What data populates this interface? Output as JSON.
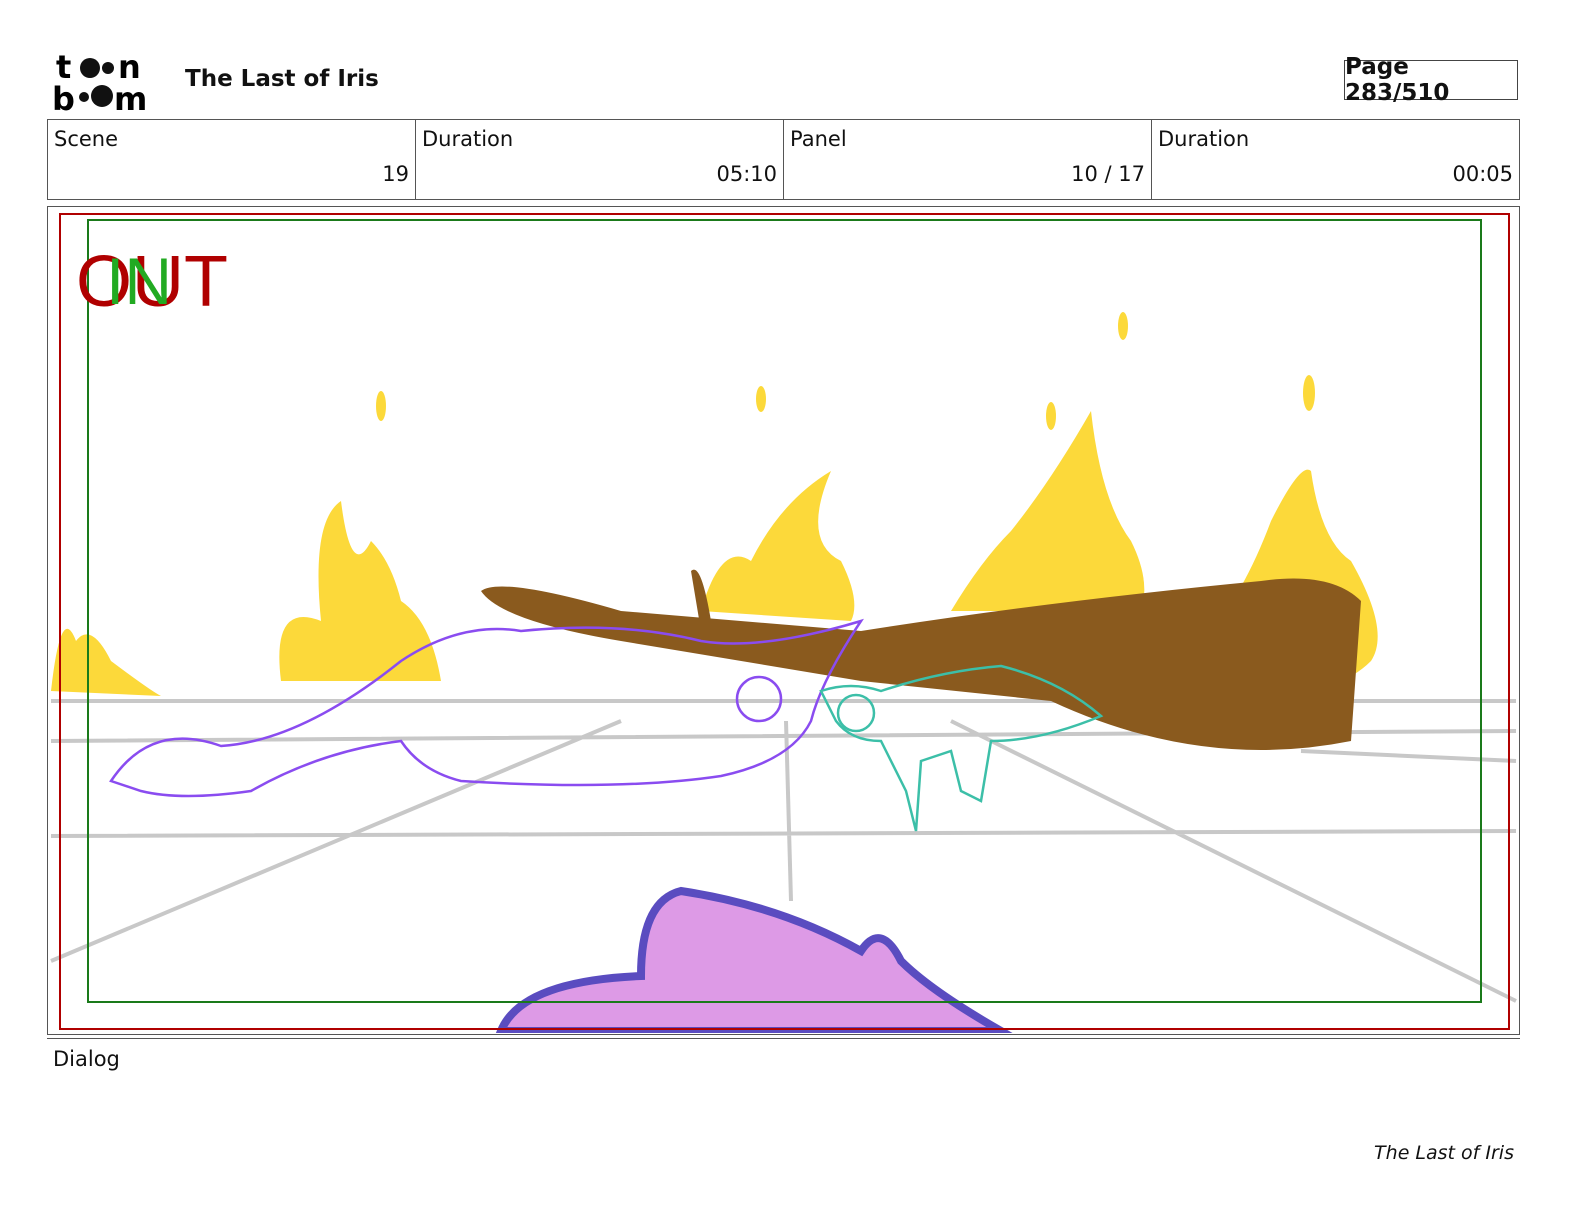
{
  "header": {
    "logo_text": "toon boom",
    "title": "The Last of Iris",
    "page_label": "Page 283/510"
  },
  "info": [
    {
      "label": "Scene",
      "value": "19"
    },
    {
      "label": "Duration",
      "value": "05:10"
    },
    {
      "label": "Panel",
      "value": "10 / 17"
    },
    {
      "label": "Duration",
      "value": "00:05"
    }
  ],
  "panel": {
    "out_marker": "OUT",
    "in_marker": "IN",
    "colors": {
      "out": "#b00000",
      "in": "#22aa22",
      "safe_frame": "#b00000",
      "title_frame": "#1a7a1a",
      "fire": "#fcd93a",
      "log": "#8a5a1e",
      "unicorn": "#8a4cf0",
      "dragon": "#3cbfa8",
      "foreground": "#dd9ae6"
    }
  },
  "dialog": {
    "label": "Dialog"
  },
  "footer": {
    "text": "The Last of Iris"
  }
}
